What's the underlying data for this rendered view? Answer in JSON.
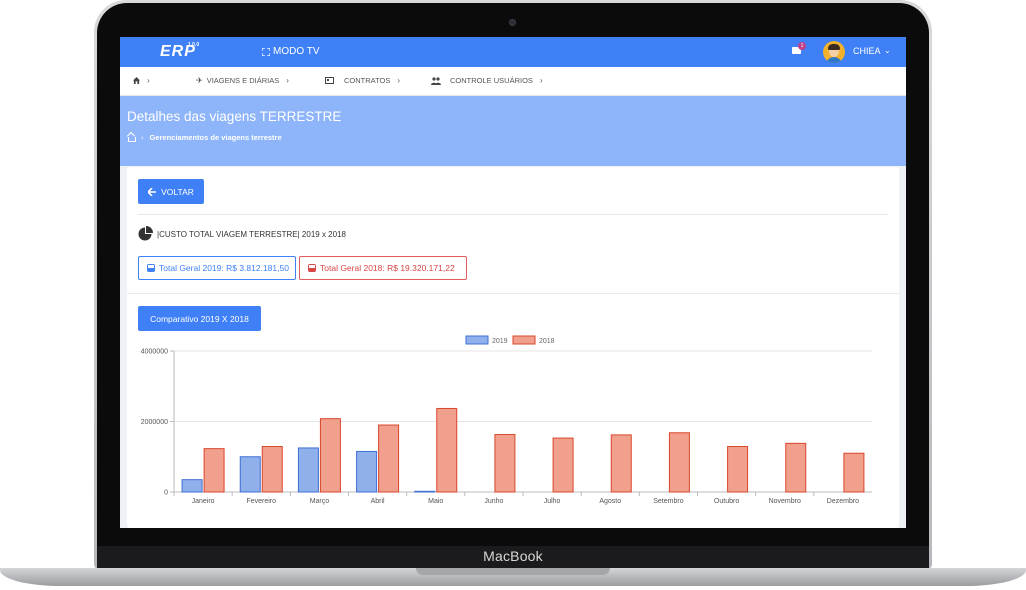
{
  "device": {
    "brand": "MacBook"
  },
  "topbar": {
    "logo": "ERP",
    "logo_version": "1.0.0",
    "modo_tv": "MODO TV",
    "notification_count": "1",
    "user_name": "CHIEA"
  },
  "menu": {
    "items": [
      {
        "label": "VIAGENS E DIÁRIAS",
        "icon": "plane-icon"
      },
      {
        "label": "CONTRATOS",
        "icon": "id-card-icon"
      },
      {
        "label": "CONTROLE USUÁRIOS",
        "icon": "users-icon"
      }
    ]
  },
  "page": {
    "title": "Detalhes das viagens TERRESTRE",
    "breadcrumb": "Gerenciamentos de viagens terrestre",
    "back_button": "VOLTAR",
    "cost_title": "|CUSTO TOTAL VIAGEM TERRESTRE| 2019 x 2018",
    "total_2019": "Total Geral 2019: R$ 3.812.181,50",
    "total_2018": "Total Geral 2018: R$ 19.320.171,22",
    "compare_button": "Comparativo 2019 X 2018"
  },
  "colors": {
    "primary": "#3f80f6",
    "banner": "#8eb4fa",
    "series_2019_fill": "#8fb0ea",
    "series_2019_stroke": "#3f6fd6",
    "series_2018_fill": "#f0a08d",
    "series_2018_stroke": "#d9472b",
    "danger": "#d84545"
  },
  "chart_data": {
    "type": "bar",
    "categories": [
      "Janeiro",
      "Fevereiro",
      "Março",
      "Abril",
      "Maio",
      "Junho",
      "Julho",
      "Agosto",
      "Setembro",
      "Outubro",
      "Novembro",
      "Dezembro"
    ],
    "series": [
      {
        "name": "2019",
        "values": [
          350000,
          1000000,
          1250000,
          1150000,
          20000,
          0,
          0,
          0,
          0,
          0,
          0,
          0
        ]
      },
      {
        "name": "2018",
        "values": [
          1230000,
          1290000,
          2080000,
          1900000,
          2370000,
          1630000,
          1530000,
          1620000,
          1680000,
          1290000,
          1380000,
          1100000
        ]
      }
    ],
    "yticks": [
      "4000000",
      "2000000",
      "0"
    ],
    "ylim": [
      0,
      4000000
    ],
    "legend_position": "top-center",
    "grid": true
  }
}
